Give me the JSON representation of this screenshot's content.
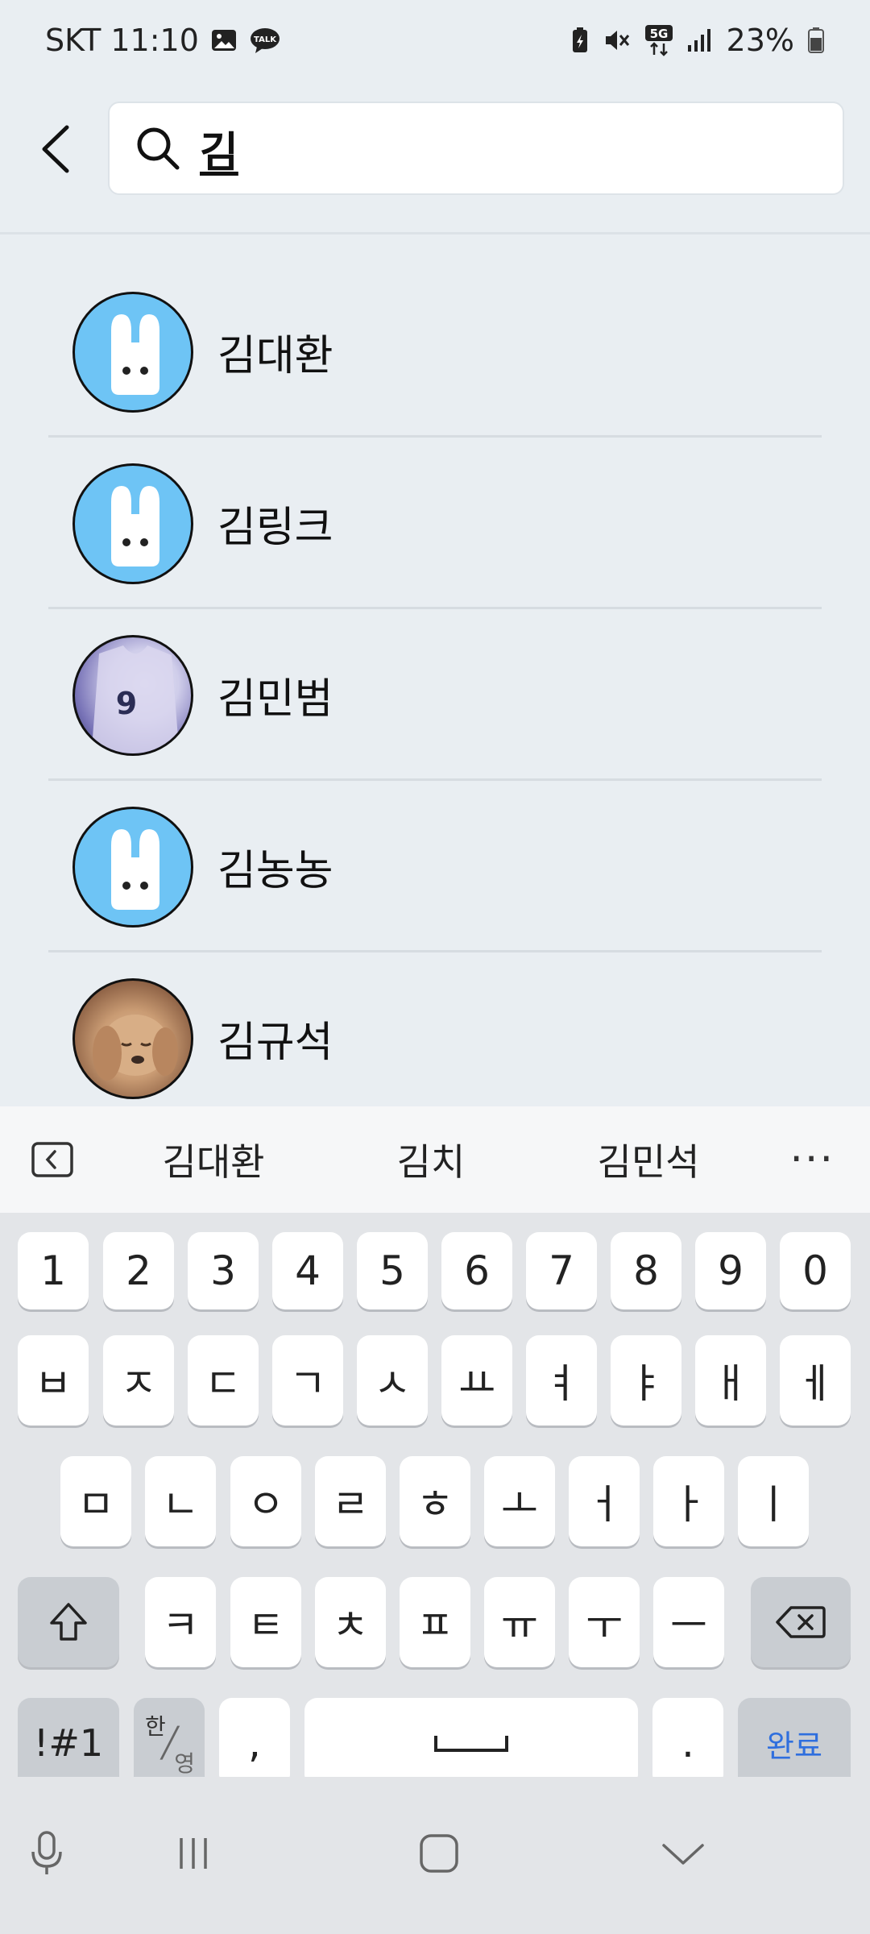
{
  "status_bar": {
    "carrier_time": "SKT 11:10",
    "battery": "23%",
    "network": "5G"
  },
  "search": {
    "query": "김"
  },
  "results": [
    {
      "name": "김대환",
      "avatar": "default-bunny-icon"
    },
    {
      "name": "김링크",
      "avatar": "default-bunny-icon"
    },
    {
      "name": "김민범",
      "avatar": "jersey-photo"
    },
    {
      "name": "김농농",
      "avatar": "default-bunny-icon"
    },
    {
      "name": "김규석",
      "avatar": "dog-photo"
    }
  ],
  "suggestions": [
    "김대환",
    "김치",
    "김민석"
  ],
  "suggestion_more": "···",
  "keyboard": {
    "row1": [
      "1",
      "2",
      "3",
      "4",
      "5",
      "6",
      "7",
      "8",
      "9",
      "0"
    ],
    "row2": [
      "ㅂ",
      "ㅈ",
      "ㄷ",
      "ㄱ",
      "ㅅ",
      "ㅛ",
      "ㅕ",
      "ㅑ",
      "ㅐ",
      "ㅔ"
    ],
    "row3": [
      "ㅁ",
      "ㄴ",
      "ㅇ",
      "ㄹ",
      "ㅎ",
      "ㅗ",
      "ㅓ",
      "ㅏ",
      "ㅣ"
    ],
    "row4": [
      "ㅋ",
      "ㅌ",
      "ㅊ",
      "ㅍ",
      "ㅠ",
      "ㅜ",
      "ㅡ"
    ],
    "symbols": "!#1",
    "lang_top": "한",
    "lang_bottom": "영",
    "comma": ",",
    "period": ".",
    "done": "완료"
  },
  "colors": {
    "background": "#e9eef2",
    "avatar_blue": "#6ec4f5",
    "done_blue": "#2f6fde"
  }
}
